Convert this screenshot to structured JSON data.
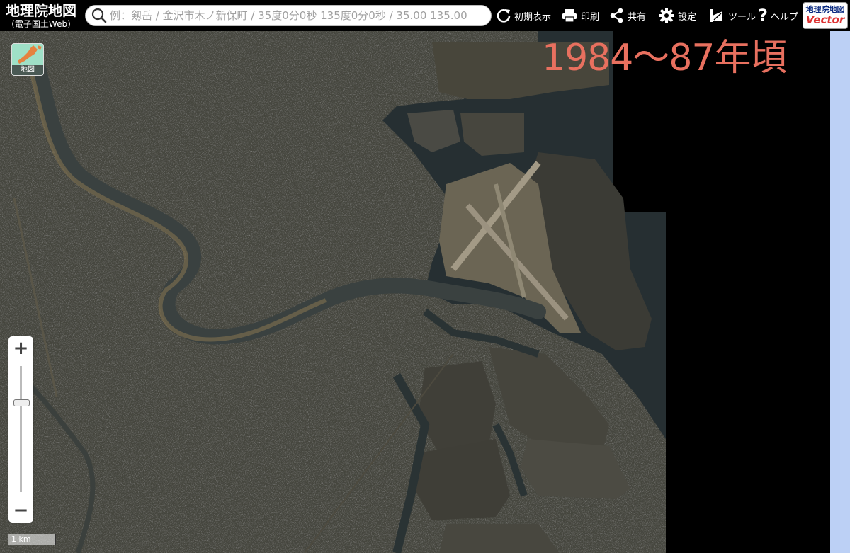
{
  "header": {
    "brand_main": "地理院地図",
    "brand_sub": "(電子国土Web)",
    "search_placeholder": "例：剱岳 / 金沢市木ノ新保町 / 35度0分0秒 135度0分0秒 / 35.00 135.00",
    "tools": {
      "reset_label": "初期表示",
      "print_label": "印刷",
      "share_label": "共有",
      "settings_label": "設定",
      "tools_label": "ツール",
      "help_label": "ヘルプ"
    },
    "logo": {
      "top": "地理院地図",
      "bottom": "Vector"
    }
  },
  "map": {
    "basemap_button_label": "地図",
    "overlay_title": "1984～87年頃",
    "zoom_in": "+",
    "zoom_out": "−",
    "scale_label": "1 km",
    "colors": {
      "title": "#e8705f",
      "water": "#262f32",
      "urban": "#34352d"
    }
  }
}
